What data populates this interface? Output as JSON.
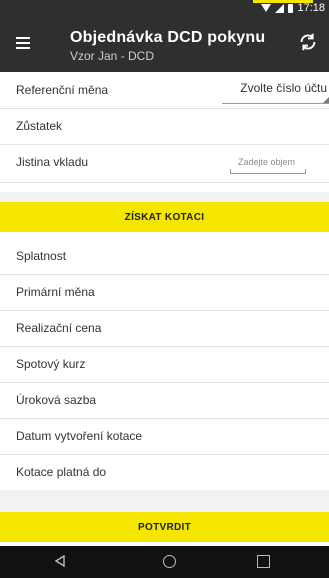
{
  "status": {
    "time": "17:18"
  },
  "header": {
    "title": "Objednávka DCD pokynu",
    "subtitle": "Vzor Jan - DCD"
  },
  "rows_top": [
    {
      "label": "Referenční měna"
    },
    {
      "label": "Zůstatek"
    },
    {
      "label": "Jistina vkladu"
    }
  ],
  "select": {
    "value": "Zvolte číslo účtu"
  },
  "input": {
    "placeholder": "Zadejte objem"
  },
  "buttons": {
    "quote": "ZÍSKAT KOTACI",
    "confirm": "POTVRDIT"
  },
  "rows_bottom": [
    {
      "label": "Splatnost"
    },
    {
      "label": "Primární měna"
    },
    {
      "label": "Realizační cena"
    },
    {
      "label": "Spotový kurz"
    },
    {
      "label": "Úroková sazba"
    },
    {
      "label": "Datum vytvoření kotace"
    },
    {
      "label": "Kotace platná do"
    }
  ],
  "colors": {
    "accent": "#f5e600",
    "appbar": "#2f2f2f"
  }
}
